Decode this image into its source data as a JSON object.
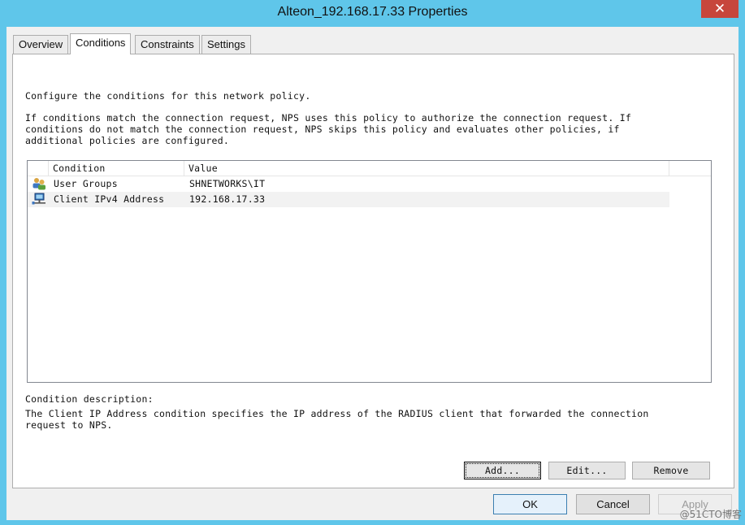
{
  "window": {
    "title": "Alteon_192.168.17.33 Properties",
    "close_glyph": "✕"
  },
  "tabs": [
    {
      "label": "Overview"
    },
    {
      "label": "Conditions",
      "active": true
    },
    {
      "label": "Constraints"
    },
    {
      "label": "Settings"
    }
  ],
  "conditions_page": {
    "intro_line": "Configure the conditions for this network policy.",
    "explanation_lines": [
      "If conditions match the connection request, NPS uses this policy to authorize the connection request. If",
      "conditions do not match the connection request, NPS skips this policy and evaluates other policies, if",
      "additional policies are configured."
    ],
    "table": {
      "columns": [
        "Condition",
        "Value"
      ],
      "rows": [
        {
          "icon": "user-groups-icon",
          "condition": "User Groups",
          "value": "SHNETWORKS\\IT"
        },
        {
          "icon": "network-computer-icon",
          "condition": "Client IPv4 Address",
          "value": "192.168.17.33",
          "selected": true
        }
      ]
    },
    "description_label": "Condition description:",
    "description_lines": [
      "The Client IP Address condition specifies the IP address of the RADIUS client that forwarded the connection",
      "request to NPS."
    ],
    "buttons": {
      "add": "Add...",
      "edit": "Edit...",
      "remove": "Remove"
    }
  },
  "dialog_buttons": {
    "ok": "OK",
    "cancel": "Cancel",
    "apply": "Apply"
  },
  "watermark": "@51CTO博客"
}
